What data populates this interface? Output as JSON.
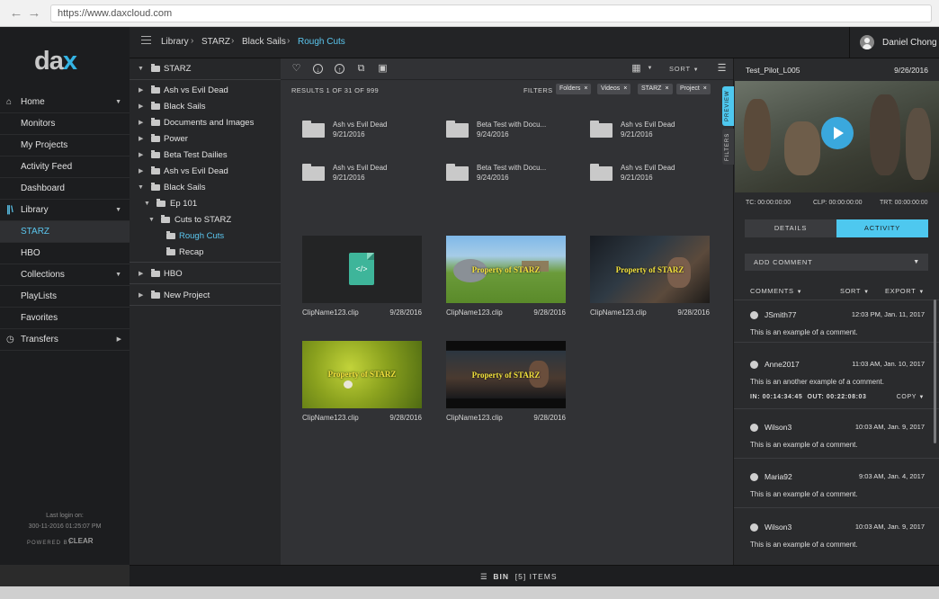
{
  "browser": {
    "url": "https://www.daxcloud.com"
  },
  "logo": {
    "text_main": "da",
    "text_accent": "x"
  },
  "sidebar": {
    "items": [
      {
        "label": "Home",
        "icon": "home-icon"
      },
      {
        "label": "Monitors"
      },
      {
        "label": "My Projects"
      },
      {
        "label": "Activity Feed"
      },
      {
        "label": "Dashboard"
      },
      {
        "label": "Library",
        "icon": "library-icon"
      },
      {
        "label": "STARZ"
      },
      {
        "label": "HBO"
      },
      {
        "label": "Collections"
      },
      {
        "label": "PlayLists"
      },
      {
        "label": "Favorites"
      },
      {
        "label": "Transfers",
        "icon": "clock-icon"
      }
    ],
    "last_login_label": "Last login on:",
    "last_login_value": "300-11-2016 01:25:07 PM",
    "powered_by": "POWERED BY",
    "powered_brand": "CLEAR"
  },
  "breadcrumb": [
    "Library",
    "STARZ",
    "Black Sails",
    "Rough Cuts"
  ],
  "user": {
    "name": "Daniel Chong"
  },
  "tree": {
    "root": "STARZ",
    "items": [
      "Ash vs Evil Dead",
      "Black Sails",
      "Documents and Images",
      "Power",
      "Beta Test Dailies",
      "Ash vs Evil Dead",
      "Black Sails",
      "Ep 101",
      "Cuts to STARZ",
      "Rough Cuts",
      "Recap",
      "HBO",
      "New Project"
    ]
  },
  "toolbar": {
    "sort_label": "SORT"
  },
  "results": {
    "text": "RESULTS 1 OF 31 OF 999",
    "filters_label": "FILTERS"
  },
  "filters": [
    "Folders",
    "Videos",
    "STARZ",
    "Project"
  ],
  "folders": [
    {
      "name": "Ash vs Evil Dead",
      "date": "9/21/2016"
    },
    {
      "name": "Beta Test with Docu...",
      "date": "9/24/2016"
    },
    {
      "name": "Ash vs Evil Dead",
      "date": "9/21/2016"
    },
    {
      "name": "Ash vs Evil Dead",
      "date": "9/21/2016"
    },
    {
      "name": "Beta Test with Docu...",
      "date": "9/24/2016"
    },
    {
      "name": "Ash vs Evil Dead",
      "date": "9/21/2016"
    }
  ],
  "clips": [
    {
      "name": "ClipName123.clip",
      "date": "9/28/2016",
      "watermark": ""
    },
    {
      "name": "ClipName123.clip",
      "date": "9/28/2016",
      "watermark": "Property of STARZ"
    },
    {
      "name": "ClipName123.clip",
      "date": "9/28/2016",
      "watermark": "Property of STARZ"
    },
    {
      "name": "ClipName123.clip",
      "date": "9/28/2016",
      "watermark": "Property of STARZ"
    },
    {
      "name": "ClipName123.clip",
      "date": "9/28/2016",
      "watermark": "Property of STARZ"
    }
  ],
  "bin": {
    "label": "BIN",
    "count": "[5]",
    "suffix": "ITEMS"
  },
  "detail": {
    "title": "Test_Pilot_L005",
    "date": "9/26/2016",
    "side_tabs": [
      "PREVIEW",
      "FILTERS"
    ],
    "progress": 0.29,
    "tc": "TC: 00:00:00:00",
    "clp": "CLP: 00:00:00:00",
    "trt": "TRT: 00:00:00:00",
    "tabs": [
      "DETAILS",
      "ACTIVITY"
    ],
    "add_comment": "ADD COMMENT",
    "comments_label": "COMMENTS",
    "sort_label": "SORT",
    "export_label": "EXPORT",
    "comments": [
      {
        "user": "JSmith77",
        "time": "12:03 PM, Jan. 11, 2017",
        "text": "This is an example of a comment."
      },
      {
        "user": "Anne2017",
        "time": "11:03 AM, Jan. 10, 2017",
        "text": "This is an another example of a comment.",
        "in": "IN: 00:14:34:45",
        "out": "OUT: 00:22:08:03",
        "copy": "COPY"
      },
      {
        "user": "Wilson3",
        "time": "10:03 AM, Jan. 9, 2017",
        "text": "This is an example of a comment."
      },
      {
        "user": "Maria92",
        "time": "9:03 AM, Jan. 4, 2017",
        "text": "This is an example of a comment."
      },
      {
        "user": "Wilson3",
        "time": "10:03 AM, Jan. 9, 2017",
        "text": "This is an example of a comment."
      }
    ]
  }
}
